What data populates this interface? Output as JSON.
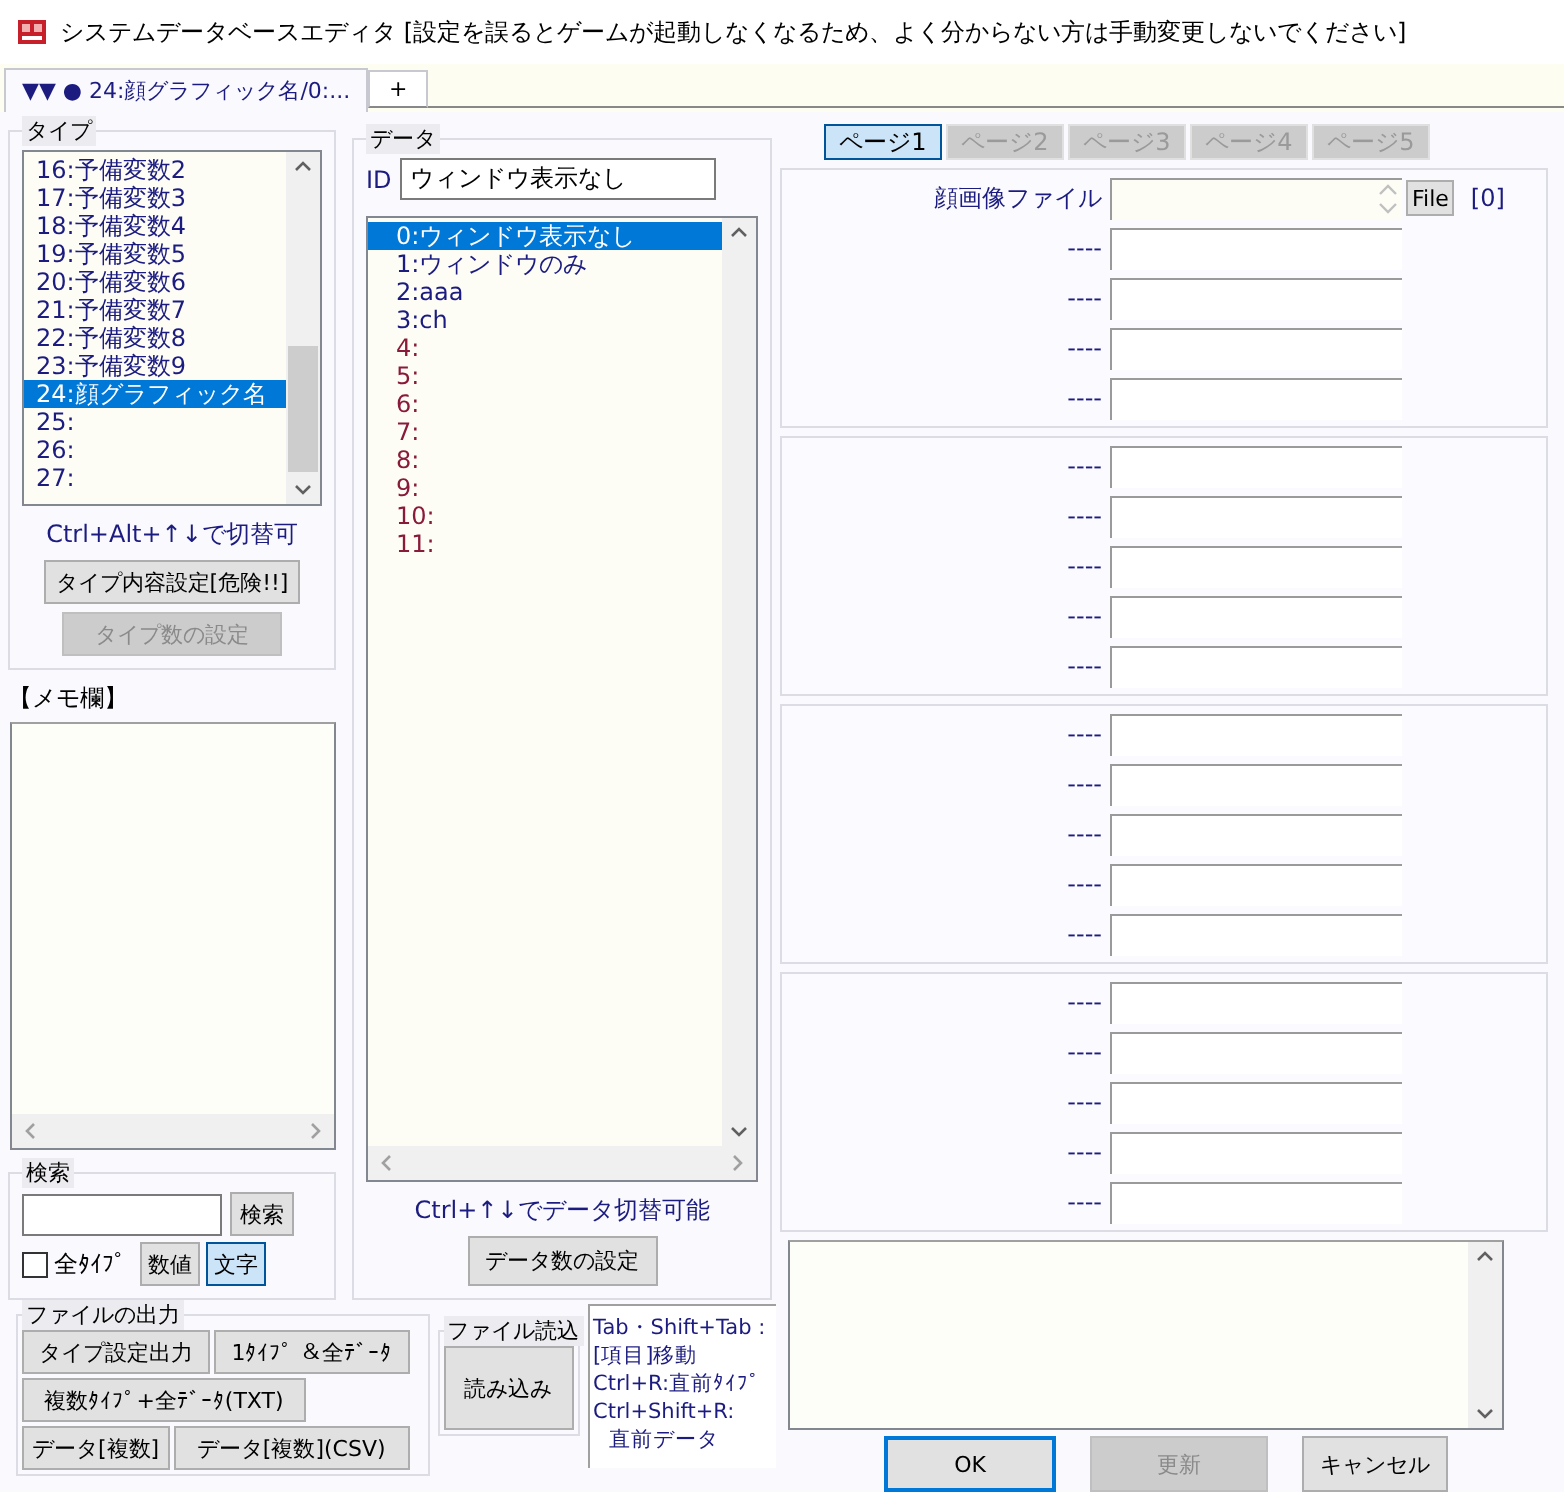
{
  "window": {
    "title": "システムデータベースエディタ  [設定を誤るとゲームが起動しなくなるため、よく分からない方は手動変更しないでください]"
  },
  "tabs": [
    {
      "label": "▼▼ ● 24:顔グラフィック名/0:...",
      "selected": true
    },
    {
      "label": "+",
      "selected": false
    }
  ],
  "type_group": {
    "title": "タイプ",
    "items": [
      {
        "label": "16:予備変数2",
        "selected": false
      },
      {
        "label": "17:予備変数3",
        "selected": false
      },
      {
        "label": "18:予備変数4",
        "selected": false
      },
      {
        "label": "19:予備変数5",
        "selected": false
      },
      {
        "label": "20:予備変数6",
        "selected": false
      },
      {
        "label": "21:予備変数7",
        "selected": false
      },
      {
        "label": "22:予備変数8",
        "selected": false
      },
      {
        "label": "23:予備変数9",
        "selected": false
      },
      {
        "label": "24:顔グラフィック名",
        "selected": true
      },
      {
        "label": "25:",
        "selected": false
      },
      {
        "label": "26:",
        "selected": false
      },
      {
        "label": "27:",
        "selected": false
      }
    ],
    "hint": "Ctrl+Alt+↑↓で切替可",
    "buttons": [
      {
        "label": "タイプ内容設定[危険!!]",
        "disabled": false
      },
      {
        "label": "タイプ数の設定",
        "disabled": true
      }
    ]
  },
  "memo": {
    "title": "【メモ欄】"
  },
  "search": {
    "title": "検索",
    "button": "検索",
    "all_types": {
      "label": "全ﾀｲﾌﾟ",
      "checked": false
    },
    "modes": [
      {
        "label": "数値",
        "selected": false
      },
      {
        "label": "文字",
        "selected": true
      }
    ]
  },
  "file_output": {
    "title": "ファイルの出力",
    "buttons": [
      "タイプ設定出力",
      "1ﾀｲﾌﾟ ＆全ﾃﾞｰﾀ",
      "複数ﾀｲﾌﾟ+全ﾃﾞｰﾀ(TXT)",
      "データ[複数]",
      "データ[複数](CSV)"
    ]
  },
  "file_load": {
    "title": "ファイル読込",
    "button": "読み込み"
  },
  "shortcuts": [
    "Tab・Shift+Tab :",
    "[項目]移動",
    "Ctrl+R:直前ﾀｲﾌﾟ",
    "Ctrl+Shift+R:",
    "直前データ"
  ],
  "data": {
    "title": "データ",
    "id_label": "ID",
    "id_value": "ウィンドウ表示なし",
    "items": [
      {
        "label": "0:ウィンドウ表示なし",
        "selected": true,
        "unset": false
      },
      {
        "label": "1:ウィンドウのみ",
        "selected": false,
        "unset": false
      },
      {
        "label": "2:aaa",
        "selected": false,
        "unset": false
      },
      {
        "label": "3:ch",
        "selected": false,
        "unset": false
      },
      {
        "label": "4:",
        "selected": false,
        "unset": true
      },
      {
        "label": "5:",
        "selected": false,
        "unset": true
      },
      {
        "label": "6:",
        "selected": false,
        "unset": true
      },
      {
        "label": "7:",
        "selected": false,
        "unset": true
      },
      {
        "label": "8:",
        "selected": false,
        "unset": true
      },
      {
        "label": "9:",
        "selected": false,
        "unset": true
      },
      {
        "label": "10:",
        "selected": false,
        "unset": true
      },
      {
        "label": "11:",
        "selected": false,
        "unset": true
      }
    ],
    "hint": "Ctrl+↑↓でデータ切替可能",
    "button": "データ数の設定"
  },
  "pages": [
    {
      "label": "ページ1",
      "selected": true
    },
    {
      "label": "ページ2",
      "selected": false
    },
    {
      "label": "ページ3",
      "selected": false
    },
    {
      "label": "ページ4",
      "selected": false
    },
    {
      "label": "ページ5",
      "selected": false
    }
  ],
  "panels": [
    {
      "fields": [
        {
          "kind": "file",
          "label": "顔画像ファイル",
          "button": "File",
          "index": "[0]"
        },
        {
          "kind": "text",
          "label": "----"
        },
        {
          "kind": "text",
          "label": "----"
        },
        {
          "kind": "text",
          "label": "----"
        },
        {
          "kind": "text",
          "label": "----"
        }
      ]
    },
    {
      "fields": [
        {
          "kind": "text",
          "label": "----"
        },
        {
          "kind": "text",
          "label": "----"
        },
        {
          "kind": "text",
          "label": "----"
        },
        {
          "kind": "text",
          "label": "----"
        },
        {
          "kind": "text",
          "label": "----"
        }
      ]
    },
    {
      "fields": [
        {
          "kind": "text",
          "label": "----"
        },
        {
          "kind": "text",
          "label": "----"
        },
        {
          "kind": "text",
          "label": "----"
        },
        {
          "kind": "text",
          "label": "----"
        },
        {
          "kind": "text",
          "label": "----"
        }
      ]
    },
    {
      "fields": [
        {
          "kind": "text",
          "label": "----"
        },
        {
          "kind": "text",
          "label": "----"
        },
        {
          "kind": "text",
          "label": "----"
        },
        {
          "kind": "text",
          "label": "----"
        },
        {
          "kind": "text",
          "label": "----"
        }
      ]
    }
  ],
  "buttons": [
    {
      "label": "OK",
      "default": true,
      "disabled": false
    },
    {
      "label": "更新",
      "default": false,
      "disabled": true
    },
    {
      "label": "キャンセル",
      "default": false,
      "disabled": false
    }
  ]
}
